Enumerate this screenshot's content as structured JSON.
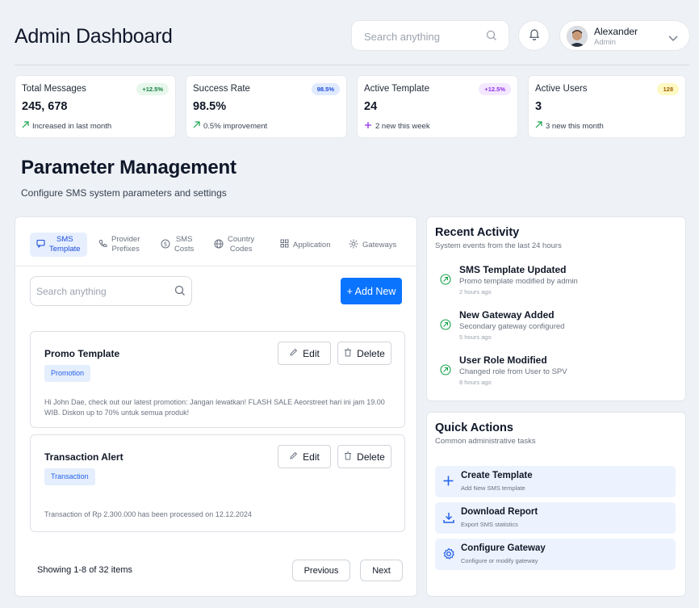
{
  "header": {
    "title": "Admin Dashboard",
    "search_placeholder": "Search anything",
    "user_name": "Alexander",
    "user_role": "Admin"
  },
  "stats": [
    {
      "label": "Total Messages",
      "value": "245, 678",
      "badge": "+12.5%",
      "sub": "Increased in last month",
      "badge_bg": "#e7f7ec",
      "badge_fg": "#15803d",
      "icon": "trend-up-icon"
    },
    {
      "label": "Success Rate",
      "value": "98.5%",
      "badge": "98.5%",
      "sub": "0.5% improvement",
      "badge_bg": "#e0eaff",
      "badge_fg": "#1d4ed8",
      "icon": "trend-up-icon"
    },
    {
      "label": "Active Template",
      "value": "24",
      "badge": "+12.5%",
      "sub": "2 new this week",
      "badge_bg": "#f3e8ff",
      "badge_fg": "#9333ea",
      "icon": "plus-icon"
    },
    {
      "label": "Active Users",
      "value": "3",
      "badge": "128",
      "sub": "3 new this month",
      "badge_bg": "#fef9c3",
      "badge_fg": "#a16207",
      "icon": "trend-up-icon"
    }
  ],
  "section": {
    "title": "Parameter Management",
    "subtitle": "Configure SMS system parameters and settings"
  },
  "tabs": [
    {
      "label": "SMS Template",
      "l1": "SMS",
      "l2": "Template",
      "icon": "message-icon",
      "active": true
    },
    {
      "label": "Provider Prefixes",
      "l1": "Provider",
      "l2": "Prefixes",
      "icon": "phone-icon"
    },
    {
      "label": "SMS Costs",
      "l1": "SMS",
      "l2": "Costs",
      "icon": "dollar-icon"
    },
    {
      "label": "Country Codes",
      "l1": "Country",
      "l2": "Codes",
      "icon": "globe-icon"
    },
    {
      "label": "Application",
      "icon": "grid-icon"
    },
    {
      "label": "Gateways",
      "icon": "gateway-icon"
    }
  ],
  "list": {
    "search_placeholder": "Search anything",
    "add_label": "+ Add New",
    "edit_label": "Edit",
    "delete_label": "Delete",
    "templates": [
      {
        "name": "Promo Template",
        "tag": "Promotion",
        "body": "Hi John Dae, check out our latest promotion: Jangan lewatkan! FLASH SALE Aeorstreet hari ini jam 19.00 WIB. Diskon up to 70% untuk semua produk!"
      },
      {
        "name": "Transaction Alert",
        "tag": "Transaction",
        "body": "Transaction of Rp 2.300.000 has been processed on 12.12.2024"
      }
    ],
    "showing": "Showing 1-8 of 32 items",
    "prev_label": "Previous",
    "next_label": "Next"
  },
  "recent": {
    "title": "Recent Activity",
    "subtitle": "System events from the last 24 hours",
    "items": [
      {
        "title": "SMS Template Updated",
        "desc": "Promo template modified by admin",
        "time": "2 hours ago"
      },
      {
        "title": "New Gateway Added",
        "desc": "Secondary gateway configured",
        "time": "5 hours ago"
      },
      {
        "title": "User Role Modified",
        "desc": "Changed role from User to SPV",
        "time": "8 hours ago"
      }
    ]
  },
  "quick": {
    "title": "Quick Actions",
    "subtitle": "Common administrative tasks",
    "items": [
      {
        "title": "Create Template",
        "desc": "Add New SMS template",
        "icon": "plus-icon"
      },
      {
        "title": "Download Report",
        "desc": "Export SMS statistics",
        "icon": "download-icon"
      },
      {
        "title": "Configure Gateway",
        "desc": "Configure or modify gateway",
        "icon": "settings-icon"
      }
    ]
  },
  "colors": {
    "accent": "#0b74ff",
    "background": "#eef1f5",
    "activity_green": "#16a34a"
  }
}
